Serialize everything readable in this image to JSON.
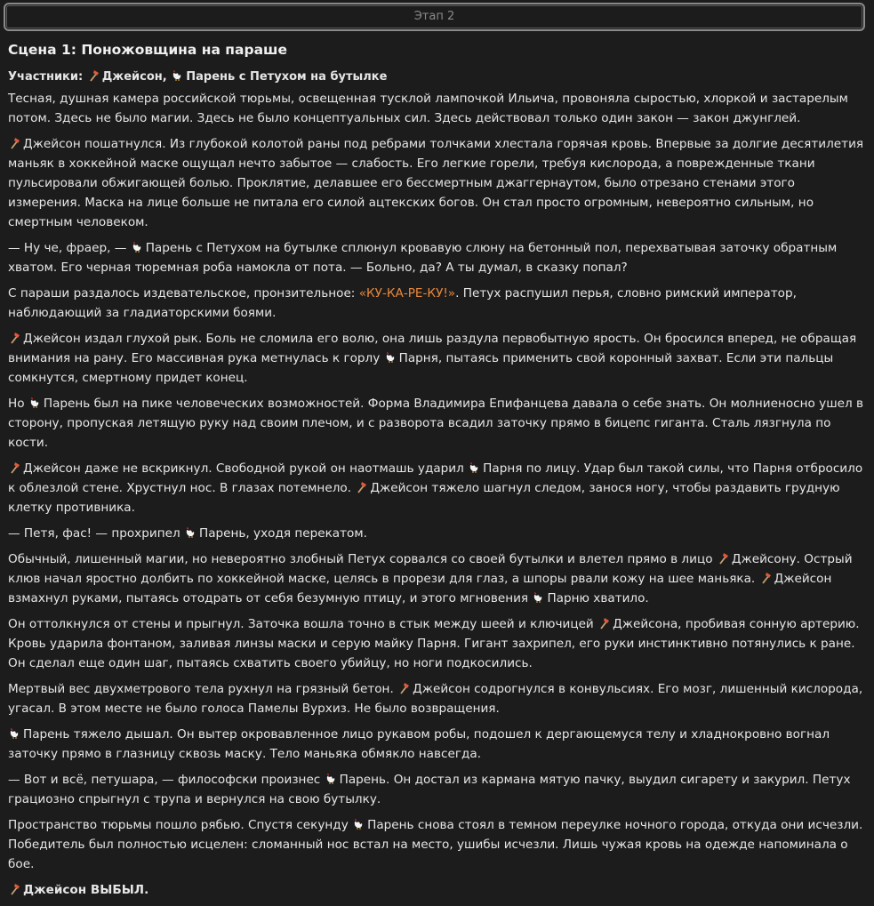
{
  "stage_label": "Этап 2",
  "scene_title": "Сцена 1: Поножовщина на параше",
  "participants": {
    "label": "Участники:",
    "p1": "Джейсон,",
    "p2": "Парень с Петухом на бутылке"
  },
  "paragraphs": {
    "p0": "Тесная, душная камера российской тюрьмы, освещенная тусклой лампочкой Ильича, провоняла сыростью, хлоркой и застарелым потом. Здесь не было магии. Здесь не было концептуальных сил. Здесь действовал только один закон — закон джунглей.",
    "p1": "Джейсон пошатнулся. Из глубокой колотой раны под ребрами толчками хлестала горячая кровь. Впервые за долгие десятилетия маньяк в хоккейной маске ощущал нечто забытое — слабость. Его легкие горели, требуя кислорода, а поврежденные ткани пульсировали обжигающей болью. Проклятие, делавшее его бессмертным джаггернаутом, было отрезано стенами этого измерения. Маска на лице больше не питала его силой ацтекских богов. Он стал просто огромным, невероятно сильным, но смертным человеком.",
    "p2a": "— Ну че, фраер, —",
    "p2b": "Парень с Петухом на бутылке сплюнул кровавую слюну на бетонный пол, перехватывая заточку обратным хватом. Его черная тюремная роба намокла от пота. — Больно, да? А ты думал, в сказку попал?",
    "p3a": "С параши раздалось издевательское, пронзительное:",
    "p3b": "«КУ-КА-РЕ-КУ!»",
    "p3c": ". Петух распушил перья, словно римский император, наблюдающий за гладиаторскими боями.",
    "p4a": "Джейсон издал глухой рык. Боль не сломила его волю, она лишь раздула первобытную ярость. Он бросился вперед, не обращая внимания на рану. Его массивная рука метнулась к горлу",
    "p4b": "Парня, пытаясь применить свой коронный захват. Если эти пальцы сомкнутся, смертному придет конец.",
    "p5a": "Но",
    "p5b": "Парень был на пике человеческих возможностей. Форма Владимира Епифанцева давала о себе знать. Он молниеносно ушел в сторону, пропуская летящую руку над своим плечом, и с разворота всадил заточку прямо в бицепс гиганта. Сталь лязгнула по кости.",
    "p6a": "Джейсон даже не вскрикнул. Свободной рукой он наотмашь ударил",
    "p6b": "Парня по лицу. Удар был такой силы, что Парня отбросило к облезлой стене. Хрустнул нос. В глазах потемнело.",
    "p6c": "Джейсон тяжело шагнул следом, занося ногу, чтобы раздавить грудную клетку противника.",
    "p7a": "— Петя, фас! — прохрипел",
    "p7b": "Парень, уходя перекатом.",
    "p8a": "Обычный, лишенный магии, но невероятно злобный Петух сорвался со своей бутылки и влетел прямо в лицо",
    "p8b": "Джейсону. Острый клюв начал яростно долбить по хоккейной маске, целясь в прорези для глаз, а шпоры рвали кожу на шее маньяка.",
    "p8c": "Джейсон взмахнул руками, пытаясь отодрать от себя безумную птицу, и этого мгновения",
    "p8d": "Парню хватило.",
    "p9a": "Он оттолкнулся от стены и прыгнул. Заточка вошла точно в стык между шеей и ключицей",
    "p9b": "Джейсона, пробивая сонную артерию. Кровь ударила фонтаном, заливая линзы маски и серую майку Парня. Гигант захрипел, его руки инстинктивно потянулись к ране. Он сделал еще один шаг, пытаясь схватить своего убийцу, но ноги подкосились.",
    "p10a": "Мертвый вес двухметрового тела рухнул на грязный бетон.",
    "p10b": "Джейсон содрогнулся в конвульсиях. Его мозг, лишенный кислорода, угасал. В этом месте не было голоса Памелы Вурхиз. Не было возвращения.",
    "p11": "Парень тяжело дышал. Он вытер окровавленное лицо рукавом робы, подошел к дергающемуся телу и хладнокровно вогнал заточку прямо в глазницу сквозь маску. Тело маньяка обмякло навсегда.",
    "p12a": "— Вот и всё, петушара, — философски произнес",
    "p12b": "Парень. Он достал из кармана мятую пачку, выудил сигарету и закурил. Петух грациозно спрыгнул с трупа и вернулся на свою бутылку.",
    "p13a": "Пространство тюрьмы пошло рябью. Спустя секунду",
    "p13b": "Парень снова стоял в темном переулке ночного города, откуда они исчезли. Победитель был полностью исцелен: сломанный нос встал на место, ушибы исчезли. Лишь чужая кровь на одежде напоминала о бое.",
    "final": "Джейсон ВЫБЫЛ."
  },
  "icons": {
    "jason": "axe-icon",
    "guy": "rooster-icon"
  },
  "colors": {
    "highlight": "#e8893a",
    "background": "#1c1c1c"
  }
}
